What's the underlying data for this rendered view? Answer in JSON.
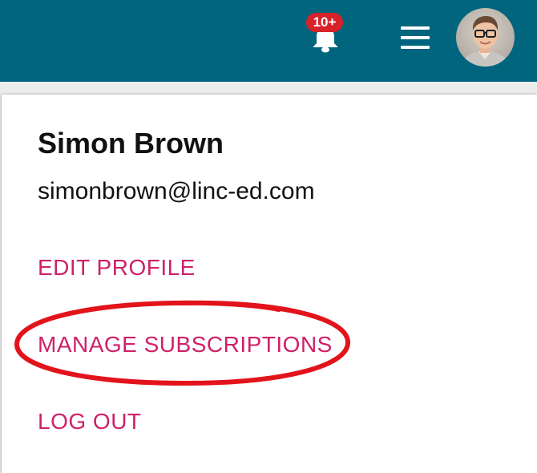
{
  "header": {
    "background_color": "#00657d",
    "notifications": {
      "badge_text": "10+",
      "badge_color": "#d7222a",
      "icon": "bell-icon"
    },
    "menu_icon": "hamburger-menu-icon",
    "avatar": "user-avatar-photo"
  },
  "profile": {
    "name": "Simon Brown",
    "email": "simonbrown@linc-ed.com"
  },
  "menu": {
    "link_color": "#cf2069",
    "edit_profile": "EDIT PROFILE",
    "manage_subscriptions": "MANAGE SUBSCRIPTIONS",
    "log_out": "LOG OUT"
  },
  "annotation": {
    "type": "hand-drawn red ellipse around MANAGE SUBSCRIPTIONS",
    "color": "#e3131b"
  }
}
